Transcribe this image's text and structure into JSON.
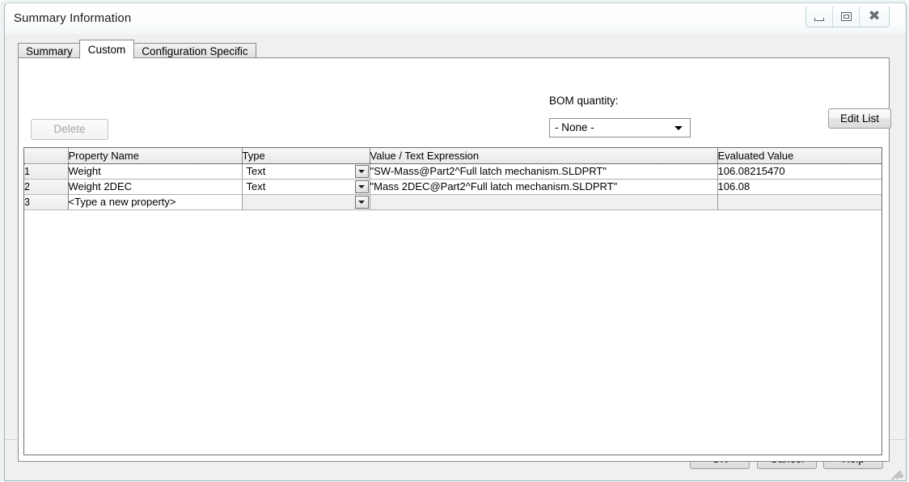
{
  "window": {
    "title": "Summary Information",
    "caption_buttons": [
      {
        "name": "minimize",
        "tooltip": "Minimize"
      },
      {
        "name": "maximize",
        "tooltip": "Maximize"
      },
      {
        "name": "close",
        "glyph": "✖",
        "tooltip": "Close"
      }
    ]
  },
  "tabs": [
    {
      "label": "Summary",
      "active": false
    },
    {
      "label": "Custom",
      "active": true
    },
    {
      "label": "Configuration Specific",
      "active": false
    }
  ],
  "toolbar": {
    "delete_label": "Delete",
    "delete_enabled": false,
    "bom_label": "BOM quantity:",
    "bom_value": "- None -",
    "bom_options": [
      "- None -"
    ],
    "edit_list_label": "Edit List"
  },
  "grid": {
    "columns": [
      "",
      "Property Name",
      "Type",
      "Value / Text Expression",
      "Evaluated Value"
    ],
    "rows": [
      {
        "num": "1",
        "property_name": "Weight",
        "type": "Text",
        "value_expression": "\"SW-Mass@Part2^Full latch mechanism.SLDPRT\"",
        "evaluated_value": "106.08215470"
      },
      {
        "num": "2",
        "property_name": "Weight 2DEC",
        "type": "Text",
        "value_expression": "\"Mass 2DEC@Part2^Full latch mechanism.SLDPRT\"",
        "evaluated_value": "106.08"
      },
      {
        "num": "3",
        "property_name": "<Type a new property>",
        "type": "",
        "value_expression": "",
        "evaluated_value": ""
      }
    ]
  },
  "footer": {
    "ok_label": "OK",
    "cancel_label": "Cancel",
    "help_label": "Help"
  },
  "colors": {
    "window_border": "#9fb8bd",
    "panel_bg": "#f0f0f0",
    "grid_header": "#eeeeee",
    "text": "#000000",
    "disabled_text": "#a6a6a6"
  }
}
